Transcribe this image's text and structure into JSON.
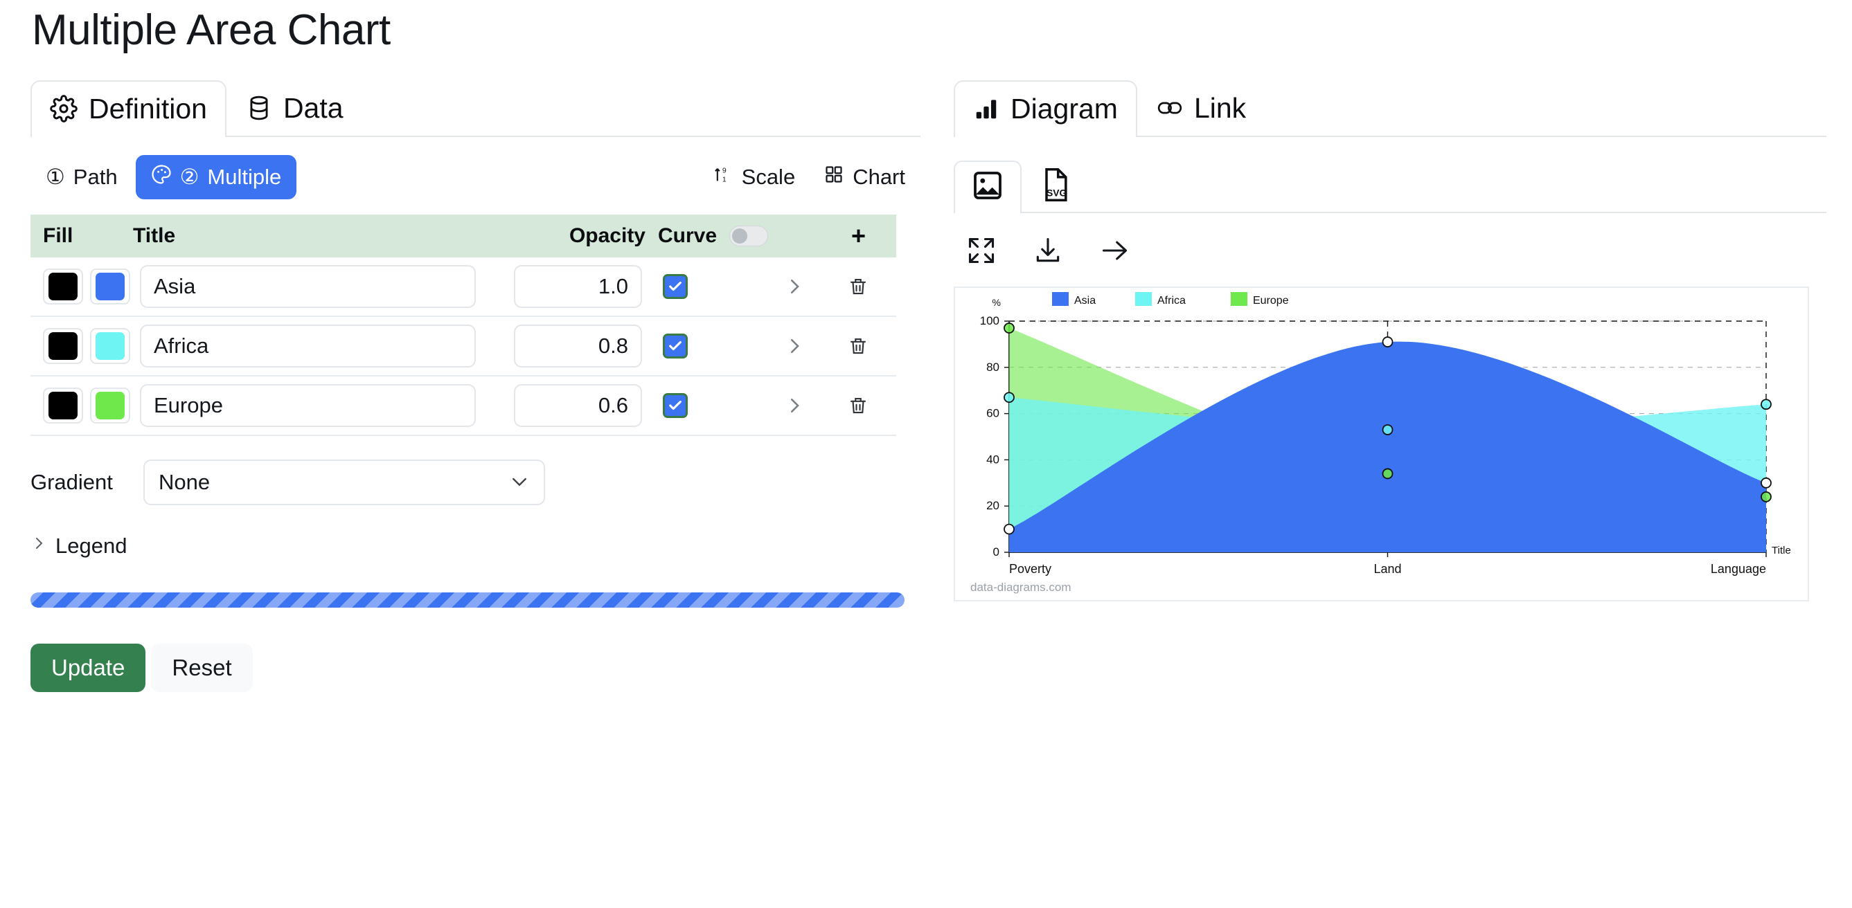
{
  "page": {
    "title": "Multiple Area Chart"
  },
  "left_panel": {
    "tabs": [
      {
        "label": "Definition",
        "icon": "gear-icon",
        "active": true
      },
      {
        "label": "Data",
        "icon": "database-icon",
        "active": false
      }
    ],
    "segments": [
      {
        "label": "Path",
        "badge": "①",
        "icon": "",
        "active": false
      },
      {
        "label": "Multiple",
        "badge": "②",
        "icon": "palette-icon",
        "active": true
      }
    ],
    "tools": [
      {
        "label": "Scale",
        "icon": "sort-arrow-icon"
      },
      {
        "label": "Chart",
        "icon": "grid-icon"
      }
    ],
    "table": {
      "headers": {
        "fill": "Fill",
        "title": "Title",
        "opacity": "Opacity",
        "curve": "Curve",
        "add": "+"
      },
      "curve_toggle_on": false,
      "rows": [
        {
          "stroke_color": "#000000",
          "fill_color": "#3b73f0",
          "title": "Asia",
          "opacity": "1.0",
          "curve_checked": true,
          "expand_icon": "chevron-right-icon",
          "delete_icon": "trash-icon"
        },
        {
          "stroke_color": "#000000",
          "fill_color": "#6ff4f4",
          "title": "Africa",
          "opacity": "0.8",
          "curve_checked": true,
          "expand_icon": "chevron-right-icon",
          "delete_icon": "trash-icon"
        },
        {
          "stroke_color": "#000000",
          "fill_color": "#6ee84a",
          "title": "Europe",
          "opacity": "0.6",
          "curve_checked": true,
          "expand_icon": "chevron-right-icon",
          "delete_icon": "trash-icon"
        }
      ]
    },
    "gradient": {
      "label": "Gradient",
      "value": "None"
    },
    "legend_section": {
      "label": "Legend",
      "expanded": false
    },
    "progress": {
      "value": 100,
      "color": "#3b73f0"
    },
    "buttons": {
      "update": "Update",
      "reset": "Reset"
    }
  },
  "right_panel": {
    "tabs": [
      {
        "label": "Diagram",
        "icon": "bar-chart-icon",
        "active": true
      },
      {
        "label": "Link",
        "icon": "link-icon",
        "active": false
      }
    ],
    "format_tabs": [
      {
        "label": "image",
        "icon": "image-icon",
        "active": true
      },
      {
        "label": "SVG",
        "icon": "svg-file-icon",
        "active": false
      }
    ],
    "actions": [
      {
        "label": "fullscreen",
        "icon": "expand-icon"
      },
      {
        "label": "download",
        "icon": "download-icon"
      },
      {
        "label": "next",
        "icon": "arrow-right-icon"
      }
    ],
    "watermark": "data-diagrams.com"
  },
  "chart_data": {
    "type": "area",
    "title": "",
    "categories": [
      "Poverty",
      "Land",
      "Language"
    ],
    "series": [
      {
        "name": "Asia",
        "color": "#3b73f0",
        "opacity": 1.0,
        "values": [
          10,
          91,
          30
        ]
      },
      {
        "name": "Africa",
        "color": "#6ff4f4",
        "opacity": 0.8,
        "values": [
          67,
          53,
          64
        ]
      },
      {
        "name": "Europe",
        "color": "#6ee84a",
        "opacity": 0.6,
        "values": [
          97,
          34,
          24
        ]
      }
    ],
    "xlabel": "Title",
    "ylabel": "%",
    "ylim": [
      0,
      100
    ],
    "yticks": [
      0,
      20,
      40,
      60,
      80,
      100
    ],
    "grid": true,
    "legend_position": "top",
    "curve": true
  }
}
